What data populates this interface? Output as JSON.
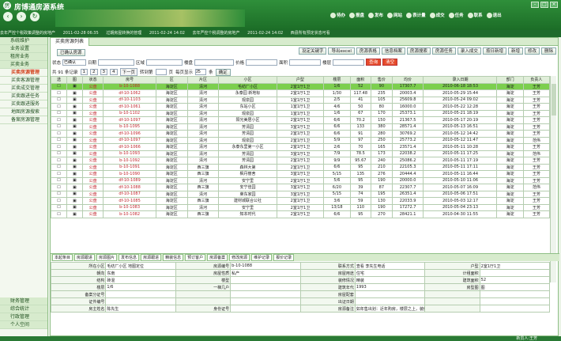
{
  "app": {
    "title": "房博通房源系统"
  },
  "window": {
    "buttons": [
      "-",
      "□",
      "×"
    ]
  },
  "nav": {
    "icons": [
      "back-icon",
      "forward-icon",
      "refresh-icon"
    ]
  },
  "toolbar": {
    "items": [
      "待办",
      "报盘",
      "发布",
      "网站",
      "表计量",
      "成交",
      "任务",
      "联系",
      "退出",
      "帮助",
      "个人",
      "注销"
    ]
  },
  "ticker": [
    "去年严控个税政策调整的房地产",
    "2011-02-28 06:35",
    "过期房屋转换的管理",
    "2011-02-24 14:02",
    "去年严控个税调整的房地产",
    "2011-02-24 14:02",
    "西县所有预定状态可看"
  ],
  "sidebar": {
    "items": [
      "系统维护",
      "业务设置",
      "租房业务",
      "买卖业务",
      "买卖房源管理",
      "买卖客源管理",
      "买卖成交管理",
      "买卖跟进任务",
      "买卖跟进服务",
      "地图房源搜索",
      "备案房源管理"
    ],
    "bottom": [
      "财务管理",
      "综合统计",
      "行政管理",
      "个人空间"
    ]
  },
  "main": {
    "tab": "买卖房源列表",
    "section": "已确认房源",
    "buttons": [
      "设定关键字",
      "导出excel",
      "房源表格",
      "信息档案",
      "房源搜索",
      "房源任务",
      "录入成交",
      "按日新增",
      "新增",
      "修改",
      "删除"
    ],
    "search": {
      "state_label": "状态",
      "state_value": "已确认",
      "date_label": "日期",
      "area_label": "区域",
      "building_label": "楼盘",
      "price_label": "价格",
      "size_label": "面积",
      "floor_label": "楼层",
      "query": "查询",
      "clear": "清空"
    },
    "pager": {
      "total": "共 91 条记录",
      "pages": [
        "1",
        "2",
        "3",
        "4",
        "下一页"
      ],
      "goto": "转到第",
      "page_unit": "页",
      "per_page": "每页显示",
      "per_value": "25",
      "unit": "条",
      "confirm": "确定"
    },
    "columns": [
      "选",
      "图",
      "状态",
      "房号",
      "区",
      "片区",
      "小区",
      "户型",
      "楼层",
      "面积",
      "售价",
      "均价",
      "录入日期",
      "部门",
      "负责人"
    ],
    "rows": [
      [
        "公盘",
        "b-10-1088",
        "海淀区",
        "清河",
        "毛纺厂小区",
        "2室1厅1卫",
        "1/6",
        "52",
        "90",
        "17307.7",
        "2010-06-18 18:53",
        "海淀",
        "王芳"
      ],
      [
        "公盘",
        "df-10-1062",
        "海淀区",
        "清河",
        "永泰园 新地标",
        "2室1厅1卫",
        "1/30",
        "117.48",
        "235",
        "20003.4",
        "2010-05-29 15:44",
        "海淀",
        "王芳"
      ],
      [
        "公盘",
        "df-10-1103",
        "海淀区",
        "清河",
        "观泉园",
        "1室1厅1卫",
        "2/5",
        "41",
        "105",
        "25609.8",
        "2010-05-24 09:02",
        "海淀",
        "王芳"
      ],
      [
        "公盘",
        "df-10-1061",
        "海淀区",
        "清河",
        "东站小区",
        "1室1厅1卫",
        "4/6",
        "50",
        "80",
        "16000.0",
        "2010-05-22 12:28",
        "海淀",
        "王芳"
      ],
      [
        "公盘",
        "b-10-1102",
        "海淀区",
        "清河",
        "观泉园",
        "1室1厅1卫",
        "1/6",
        "67",
        "170",
        "25373.1",
        "2010-05-21 18:19",
        "海淀",
        "王芳"
      ],
      [
        "公盘",
        "df-10-1097",
        "海淀区",
        "清河",
        "阳光美居小区",
        "2室1厅1卫",
        "6/6",
        "70.2",
        "150",
        "21367.5",
        "2010-05-17 20:19",
        "海淀",
        "王芳"
      ],
      [
        "公盘",
        "b-10-1095",
        "海淀区",
        "清河",
        "芳清园",
        "3室1厅1卫",
        "6/6",
        "133",
        "380",
        "28571.4",
        "2010-05-13 16:51",
        "海淀",
        "王芳"
      ],
      [
        "公盘",
        "df-10-1096",
        "海淀区",
        "清河",
        "芳清园",
        "2室1厅1卫",
        "6/6",
        "91",
        "280",
        "30769.2",
        "2010-05-12 14:42",
        "海淀",
        "王芳"
      ],
      [
        "公盘",
        "df-10-1097",
        "海淀区",
        "清河",
        "观泉园",
        "2室1厅1卫",
        "5/9",
        "97",
        "250",
        "25773.2",
        "2010-05-12 11:47",
        "海淀",
        "范伟"
      ],
      [
        "公盘",
        "df-10-1066",
        "海淀区",
        "清河",
        "永泰东里第一小区",
        "2室1厅1卫",
        "2/6",
        "70",
        "165",
        "23571.4",
        "2010-05-11 10:28",
        "海淀",
        "王芳"
      ],
      [
        "公盘",
        "b-10-1093",
        "海淀区",
        "清河",
        "芳清园",
        "3室1厅1卫",
        "7/9",
        "78.5",
        "173",
        "22038.2",
        "2010-05-11 17:25",
        "海淀",
        "范伟"
      ],
      [
        "公盘",
        "b-10-1092",
        "海淀区",
        "清河",
        "芳清园",
        "2室1厅1卫",
        "9/9",
        "95.67",
        "240",
        "25086.2",
        "2010-05-11 17:19",
        "海淀",
        "王芳"
      ],
      [
        "公盘",
        "b-10-1091",
        "海淀区",
        "西三旗",
        "森林大第",
        "2室1厅1卫",
        "6/6",
        "95",
        "210",
        "22105.3",
        "2010-05-11 17:11",
        "海淀",
        "王芳"
      ],
      [
        "公盘",
        "b-10-1090",
        "海淀区",
        "西三旗",
        "枫丹丽舍",
        "3室1厅1卫",
        "5/15",
        "135",
        "276",
        "20444.4",
        "2010-05-11 16:44",
        "海淀",
        "王芳"
      ],
      [
        "公盘",
        "df-10-1089",
        "海淀区",
        "清河",
        "安宁里",
        "2室1厅1卫",
        "5/6",
        "95",
        "190",
        "20000.0",
        "2010-05-10 11:06",
        "海淀",
        "王芳"
      ],
      [
        "公盘",
        "df-10-1088",
        "海淀区",
        "西三旗",
        "安宁佳园",
        "3室1厅1卫",
        "6/20",
        "39",
        "87",
        "22307.7",
        "2010-05-07 16:09",
        "海淀",
        "范伟"
      ],
      [
        "公盘",
        "df-10-1087",
        "海淀区",
        "清河",
        "莱东家园",
        "3室1厅1卫",
        "5/15",
        "74",
        "195",
        "26351.4",
        "2010-05-06 17:51",
        "海淀",
        "王芳"
      ],
      [
        "公盘",
        "df-10-1085",
        "海淀区",
        "西三旗",
        "建材城联合公社",
        "2室1厅1卫",
        "3/6",
        "59",
        "130",
        "22033.9",
        "2010-05-03 12:17",
        "海淀",
        "王芳"
      ],
      [
        "公盘",
        "b-10-1083",
        "海淀区",
        "清河",
        "安宁里",
        "2室1厅1卫",
        "13/18",
        "110",
        "190",
        "17272.7",
        "2010-05-04 23:13",
        "海淀",
        "王芳"
      ],
      [
        "公盘",
        "b-10-1082",
        "海淀区",
        "西三旗",
        "知本时代",
        "2室1厅1卫",
        "6/6",
        "95",
        "270",
        "28421.1",
        "2010-04-30 11:55",
        "海淀",
        "王芳"
      ]
    ],
    "detail_tabs": [
      "本起条目",
      "房源跟进",
      "房源图片",
      "发布信息",
      "房源跟进",
      "精装信息",
      "预订客户",
      "房源备案",
      "修改房源",
      "维护记录",
      "报价记录"
    ],
    "detail": [
      [
        "所在小区",
        "毛纺厂小区 地图定位",
        "房源编号",
        "b-10-1088",
        "联系方式",
        "查看 李先生电话",
        "户型",
        "2室1厅1卫"
      ],
      [
        "朝向",
        "东南",
        "房屋性质",
        "私产",
        "房屋用途",
        "住宅",
        "计租面积",
        ""
      ],
      [
        "结构",
        "砖混",
        "楼型",
        "",
        "装修情况",
        "精装",
        "建筑面积",
        "52"
      ],
      [
        "楼层",
        "1/6",
        "一梯几户",
        "",
        "建筑年代",
        "1993",
        "房型图",
        "图"
      ],
      [
        "备案分证号",
        "",
        "",
        "",
        "房屋配套",
        "",
        "",
        ""
      ],
      [
        "证件编号",
        "",
        "",
        "",
        "出证日期",
        "",
        "",
        ""
      ],
      [
        "房主姓名",
        "陈先生",
        "身份证号",
        "",
        "房源备注",
        "如年售出划：近年购房，楼层之上，装修还好…",
        "",
        ""
      ]
    ]
  },
  "status": {
    "user": "新员人:王芳"
  }
}
